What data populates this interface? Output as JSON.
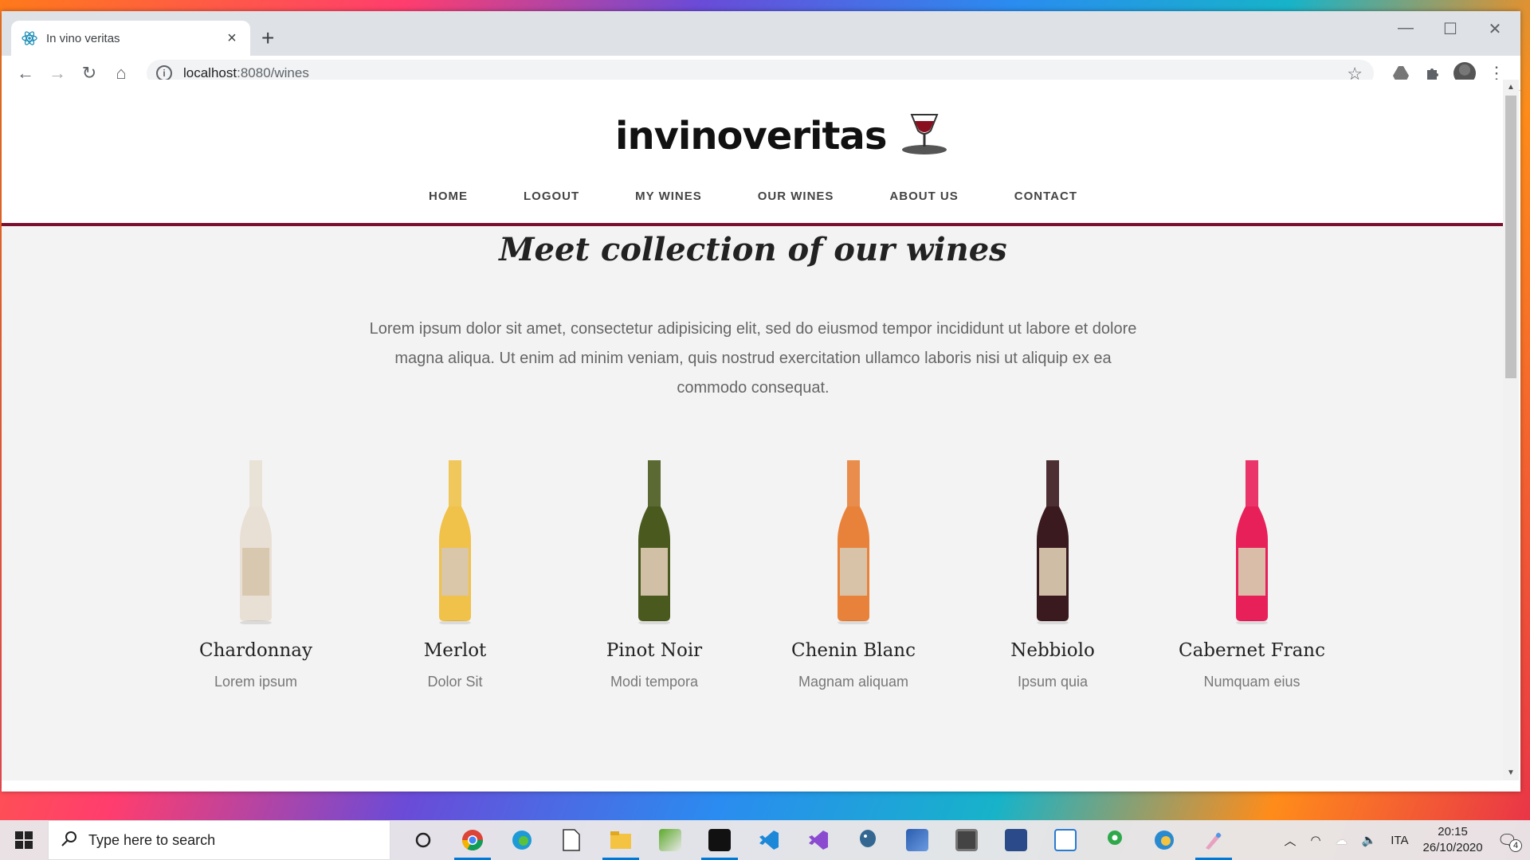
{
  "browser": {
    "tab_title": "In vino veritas",
    "new_tab": "+",
    "url_host": "localhost",
    "url_path": ":8080/wines"
  },
  "site": {
    "logo_text": "invinoveritas",
    "nav": [
      "HOME",
      "LOGOUT",
      "MY WINES",
      "OUR WINES",
      "ABOUT US",
      "CONTACT"
    ],
    "heading": "Meet collection of our wines",
    "lead": "Lorem ipsum dolor sit amet, consectetur adipisicing elit, sed do eiusmod tempor incididunt ut labore et dolore magna aliqua. Ut enim ad minim veniam, quis nostrud exercitation ullamco laboris nisi ut aliquip ex ea commodo consequat.",
    "wines": [
      {
        "name": "Chardonnay",
        "sub": "Lorem ipsum",
        "color": "#e8e0d4"
      },
      {
        "name": "Merlot",
        "sub": "Dolor Sit",
        "color": "#f0c24a"
      },
      {
        "name": "Pinot Noir",
        "sub": "Modi tempora",
        "color": "#4a5a1e"
      },
      {
        "name": "Chenin Blanc",
        "sub": "Magnam aliquam",
        "color": "#e8823a"
      },
      {
        "name": "Nebbiolo",
        "sub": "Ipsum quia",
        "color": "#3a1a1e"
      },
      {
        "name": "Cabernet Franc",
        "sub": "Numquam eius",
        "color": "#e8205a"
      }
    ]
  },
  "taskbar": {
    "search_placeholder": "Type here to search",
    "language": "ITA",
    "time": "20:15",
    "date": "26/10/2020",
    "notifications": "4"
  },
  "colors": {
    "accent": "#7a0f2e"
  }
}
